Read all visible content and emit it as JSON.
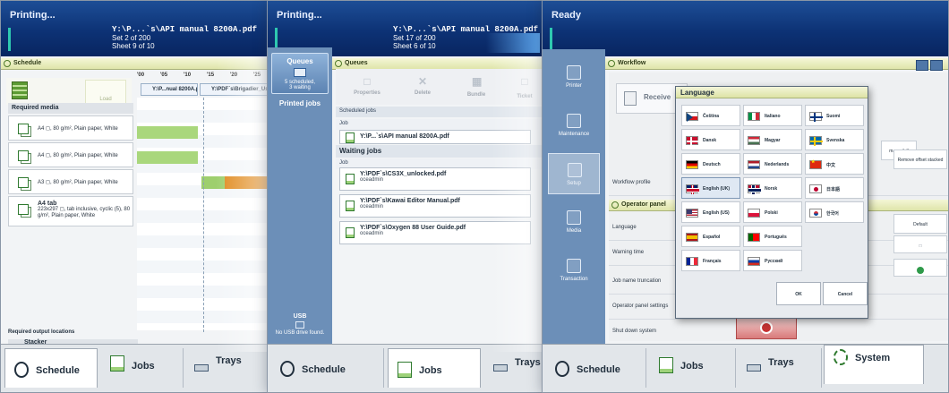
{
  "panels": {
    "left": {
      "status": {
        "title": "Printing...",
        "file": "Y:\\P...`s\\API manual 8200A.pdf",
        "set": "Set 2 of 200",
        "sheet": "Sheet 9 of 10"
      },
      "header": "Schedule",
      "load_label": "Load",
      "ruler": [
        "'00",
        "'05",
        "'10",
        "'15",
        "'20",
        "'25"
      ],
      "required_media_label": "Required media",
      "media": [
        "A4 ◻, 80 g/m², Plain paper, White",
        "A4 ◻, 80 g/m², Plain paper, White",
        "A3 ◻, 80 g/m², Plain paper, White"
      ],
      "media_tab_title": "A4 tab",
      "media_tab_detail": "223x297 ◻, tab inclusive, cyclic (5), 80 g/m², Plain paper, White",
      "jobs": [
        "Y:\\P...nual 8200A.pdf",
        "Y:\\PDF`s\\Brigadier_UserM"
      ],
      "output_label": "Required output locations",
      "output_item": "Stacker",
      "tabs": {
        "schedule": "Schedule",
        "jobs": "Jobs",
        "trays": "Trays"
      }
    },
    "middle": {
      "status": {
        "title": "Printing...",
        "file": "Y:\\P...`s\\API manual 8200A.pdf",
        "set": "Set 17 of 200",
        "sheet": "Sheet 6 of 10"
      },
      "sidebar": {
        "queues": "Queues",
        "queues_info_1": "5 scheduled,",
        "queues_info_2": "3 waiting",
        "printed": "Printed jobs",
        "usb": "USB",
        "usb_info": "No USB drive found."
      },
      "header": "Queues",
      "toolbar": {
        "properties": "Properties",
        "delete": "Delete",
        "bundle": "Bundle",
        "ticket": "Ticket"
      },
      "scheduled_label": "Scheduled jobs",
      "job_col": "Job",
      "scheduled_job": "Y:\\P...`s\\API manual 8200A.pdf",
      "waiting_label": "Waiting jobs",
      "waiting_job_col": "Job",
      "waiting": [
        {
          "name": "Y:\\PDF`s\\CS3X_unlocked.pdf",
          "user": "oceadmin"
        },
        {
          "name": "Y:\\PDF`s\\Kawai Editor Manual.pdf",
          "user": "oceadmin"
        },
        {
          "name": "Y:\\PDF`s\\Oxygen 88 User Guide.pdf",
          "user": "oceadmin"
        }
      ],
      "tabs": {
        "schedule": "Schedule",
        "jobs": "Jobs",
        "trays": "Trays"
      }
    },
    "right": {
      "status": {
        "title": "Ready"
      },
      "sidebar": [
        "Printer",
        "Maintenance",
        "Setup",
        "Media",
        "Transaction"
      ],
      "header": "Workflow",
      "receive": "Receive",
      "rows": {
        "workflow_profile": "Workflow profile",
        "operator_panel": "Operator panel",
        "language": "Language",
        "warning_time": "Warning time",
        "job_name_truncation": "Job name truncation",
        "operator_panel_settings": "Operator panel settings",
        "shut_down_system": "Shut down system"
      },
      "side_buttons": {
        "default": "Default",
        "may_a_full": "may a full",
        "remove_offset": "Remove offset stacked"
      },
      "dialog": {
        "title": "Language",
        "languages": [
          {
            "label": "Čeština",
            "flag": "cz"
          },
          {
            "label": "Italiano",
            "flag": "it"
          },
          {
            "label": "Suomi",
            "flag": "fi"
          },
          {
            "label": "Dansk",
            "flag": "dk"
          },
          {
            "label": "Magyar",
            "flag": "hu"
          },
          {
            "label": "Svenska",
            "flag": "se"
          },
          {
            "label": "Deutsch",
            "flag": "de"
          },
          {
            "label": "Nederlands",
            "flag": "nl"
          },
          {
            "label": "中文",
            "flag": "cn"
          },
          {
            "label": "English (UK)",
            "flag": "uk"
          },
          {
            "label": "Norsk",
            "flag": "no"
          },
          {
            "label": "日本語",
            "flag": "jp"
          },
          {
            "label": "English (US)",
            "flag": "us"
          },
          {
            "label": "Polski",
            "flag": "pl"
          },
          {
            "label": "한국어",
            "flag": "kr"
          },
          {
            "label": "Español",
            "flag": "es"
          },
          {
            "label": "Português",
            "flag": "pt"
          },
          {
            "label": "Français",
            "flag": "fr"
          },
          {
            "label": "Русский",
            "flag": "ru"
          }
        ],
        "selected": "English (UK)",
        "ok": "OK",
        "cancel": "Cancel"
      },
      "tabs": {
        "schedule": "Schedule",
        "jobs": "Jobs",
        "trays": "Trays",
        "system": "System"
      }
    }
  },
  "colors": {
    "status_bar": "#0d3275",
    "accent_green": "#2f7a2f",
    "sidebar": "#6c8fb8",
    "schedule_green": "#9ecf6e",
    "schedule_orange": "#e08a1e"
  }
}
